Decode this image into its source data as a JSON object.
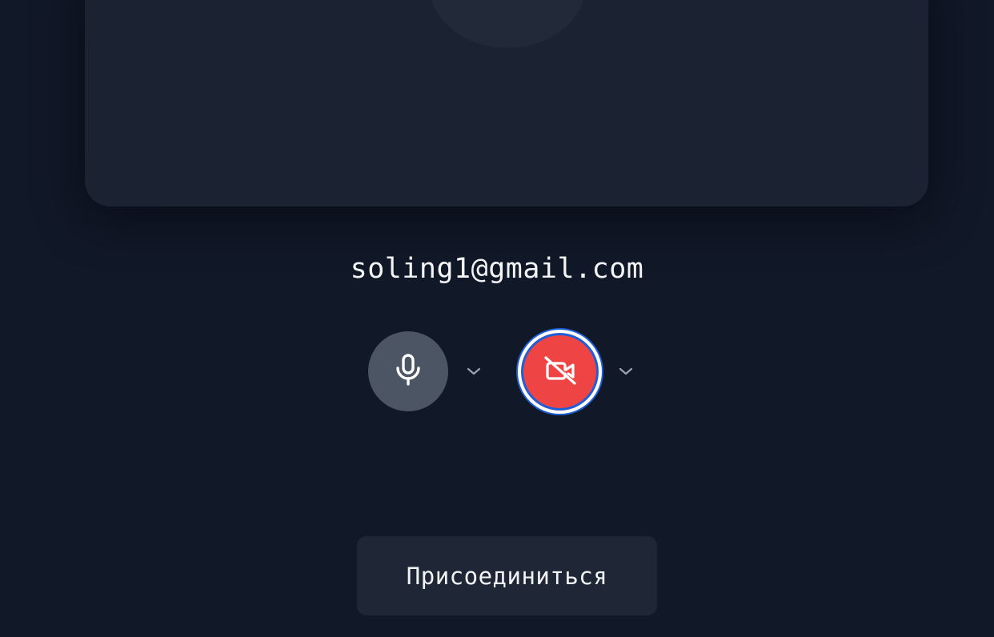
{
  "user": {
    "email": "soling1@gmail.com"
  },
  "controls": {
    "microphone": {
      "icon": "microphone-icon",
      "state": "on",
      "color": "#4b5563"
    },
    "camera": {
      "icon": "video-off-icon",
      "state": "off",
      "color": "#ef4444"
    },
    "dropdown_icon": "chevron-down-icon"
  },
  "join_button": {
    "label": "Присоединиться"
  },
  "colors": {
    "background": "#111827",
    "preview_card": "#1b2231",
    "focus_ring": "#1d5fd8"
  }
}
